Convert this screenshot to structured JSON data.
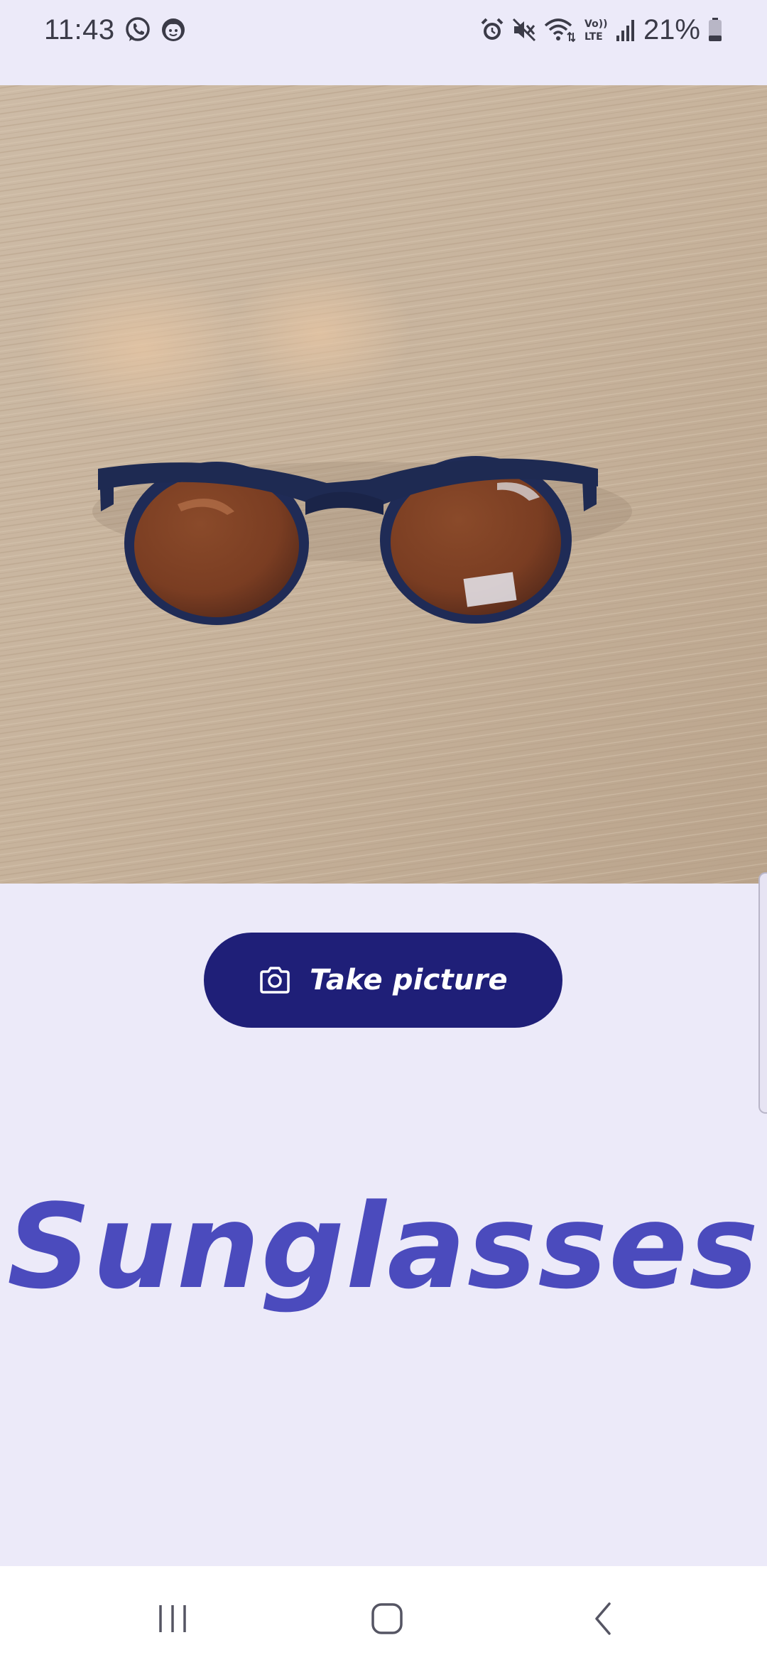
{
  "status_bar": {
    "time": "11:43",
    "battery_text": "21%",
    "left_icons": [
      "whatsapp-icon",
      "kid-face-icon"
    ],
    "right_icons": [
      "alarm-icon",
      "mute-icon",
      "wifi-icon",
      "volte-icon",
      "signal-icon",
      "battery-icon"
    ],
    "volte_label_top": "Vo))",
    "volte_label_bottom": "LTE"
  },
  "photo": {
    "description_icon": "captured-photo"
  },
  "take_picture_button": {
    "label": "Take picture",
    "icon": "camera-icon",
    "color": "#1f1f78"
  },
  "result": {
    "label": "Sunglasses",
    "color": "#4b4bbd"
  },
  "nav_bar": {
    "buttons": [
      "recents-icon",
      "home-icon",
      "back-icon"
    ]
  },
  "colors": {
    "background": "#eceaf9",
    "nav_background": "#ffffff"
  }
}
